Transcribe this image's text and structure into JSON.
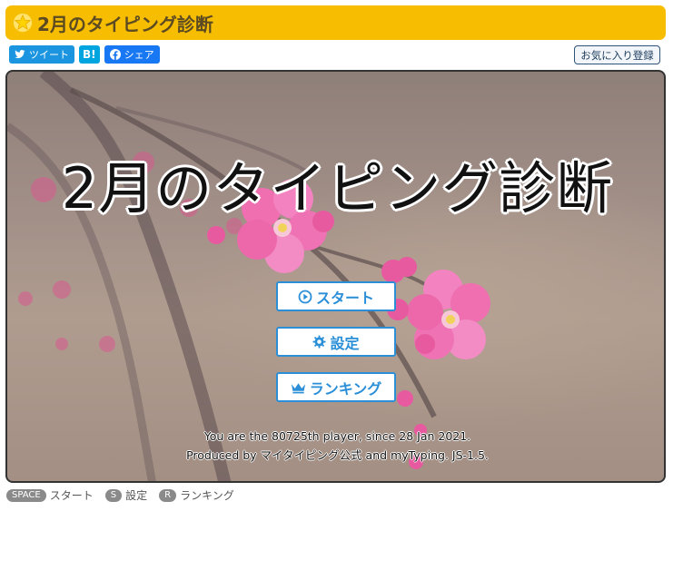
{
  "title_bar": {
    "title": "2月のタイピング診断",
    "icon": "star-icon"
  },
  "share": {
    "tweet_label": "ツイート",
    "hatena_label": "B!",
    "facebook_label": "シェア"
  },
  "favorite_label": "お気に入り登録",
  "stage": {
    "big_title": "2月のタイピング診断",
    "buttons": {
      "start": "スタート",
      "settings": "設定",
      "ranking": "ランキング"
    },
    "info_line1": "You are the 80725th player, since 28 Jan 2021.",
    "info_line2": "Produced by マイタイピング公式 and myTyping. JS-1.5."
  },
  "shortcuts": [
    {
      "key": "SPACE",
      "label": "スタート"
    },
    {
      "key": "S",
      "label": "設定"
    },
    {
      "key": "R",
      "label": "ランキング"
    }
  ],
  "colors": {
    "title_bar": "#f7bd00",
    "button_accent": "#2b8fd8",
    "blossom": "#f07cb8"
  }
}
